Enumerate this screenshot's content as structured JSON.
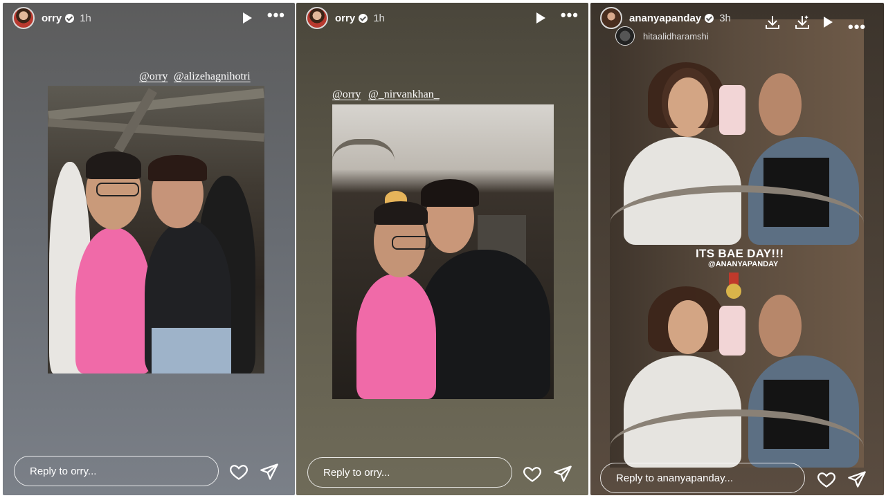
{
  "stories": [
    {
      "username": "orry",
      "time": "1h",
      "mentions": [
        "@orry",
        "@alizehagnihotri"
      ],
      "reply_placeholder": "Reply to orry..."
    },
    {
      "username": "orry",
      "time": "1h",
      "mentions": [
        "@orry",
        "@_nirvankhan_"
      ],
      "reply_placeholder": "Reply to orry..."
    },
    {
      "username": "ananyapanday",
      "time": "3h",
      "sub_username": "hitaalidharamshi",
      "caption": "ITS BAE DAY!!!",
      "caption_mention": "@ANANYAPANDAY",
      "reply_placeholder": "Reply to ananyapanday..."
    }
  ],
  "icons": {
    "play": "play-icon",
    "more": "more-options-icon",
    "like": "heart-icon",
    "share": "send-icon",
    "download": "download-icon",
    "remix": "remix-icon"
  },
  "colors": {
    "pink_shirt": "#f06aa8",
    "white": "#ffffff"
  }
}
